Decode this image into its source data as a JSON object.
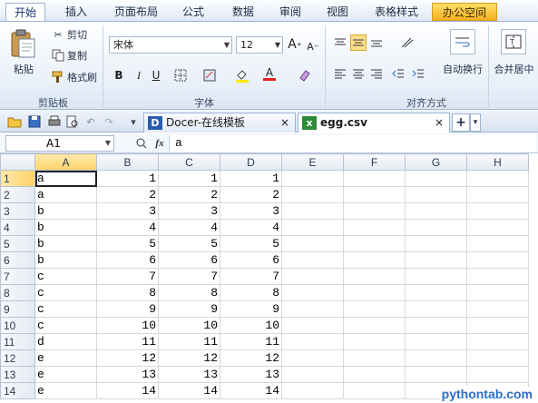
{
  "menu": {
    "items": [
      "开始",
      "插入",
      "页面布局",
      "公式",
      "数据",
      "审阅",
      "视图",
      "表格样式",
      "办公空间"
    ],
    "active": 0,
    "accent": "#15397a"
  },
  "ribbon": {
    "clipboard": {
      "paste": "粘贴",
      "cut": "剪切",
      "copy": "复制",
      "format_painter": "格式刷",
      "group_label": "剪贴板"
    },
    "font": {
      "name": "宋体",
      "size": "12",
      "grow": "A",
      "shrink": "A",
      "bold": "B",
      "italic": "I",
      "underline": "U",
      "font_color_letter": "A",
      "group_label": "字体"
    },
    "align": {
      "wrap": "自动换行",
      "merge": "合并居中",
      "group_label": "对齐方式"
    }
  },
  "tabs": [
    {
      "icon": "D",
      "label": "Docer-在线模板",
      "close": "×"
    },
    {
      "icon": "x",
      "label": "egg.csv",
      "close": "×"
    }
  ],
  "new_tab": "+",
  "formula": {
    "name_box": "A1",
    "fx": "fx",
    "value": "a"
  },
  "sheet": {
    "columns": [
      "A",
      "B",
      "C",
      "D",
      "E",
      "F",
      "G",
      "H"
    ],
    "rows": [
      {
        "n": "1",
        "a": "a",
        "b": "1",
        "c": "1",
        "d": "1"
      },
      {
        "n": "2",
        "a": "a",
        "b": "2",
        "c": "2",
        "d": "2"
      },
      {
        "n": "3",
        "a": "b",
        "b": "3",
        "c": "3",
        "d": "3"
      },
      {
        "n": "4",
        "a": "b",
        "b": "4",
        "c": "4",
        "d": "4"
      },
      {
        "n": "5",
        "a": "b",
        "b": "5",
        "c": "5",
        "d": "5"
      },
      {
        "n": "6",
        "a": "b",
        "b": "6",
        "c": "6",
        "d": "6"
      },
      {
        "n": "7",
        "a": "c",
        "b": "7",
        "c": "7",
        "d": "7"
      },
      {
        "n": "8",
        "a": "c",
        "b": "8",
        "c": "8",
        "d": "8"
      },
      {
        "n": "9",
        "a": "c",
        "b": "9",
        "c": "9",
        "d": "9"
      },
      {
        "n": "10",
        "a": "c",
        "b": "10",
        "c": "10",
        "d": "10"
      },
      {
        "n": "11",
        "a": "d",
        "b": "11",
        "c": "11",
        "d": "11"
      },
      {
        "n": "12",
        "a": "e",
        "b": "12",
        "c": "12",
        "d": "12"
      },
      {
        "n": "13",
        "a": "e",
        "b": "13",
        "c": "13",
        "d": "13"
      },
      {
        "n": "14",
        "a": "e",
        "b": "14",
        "c": "14",
        "d": "14"
      }
    ]
  },
  "watermark": "pythontab.com"
}
